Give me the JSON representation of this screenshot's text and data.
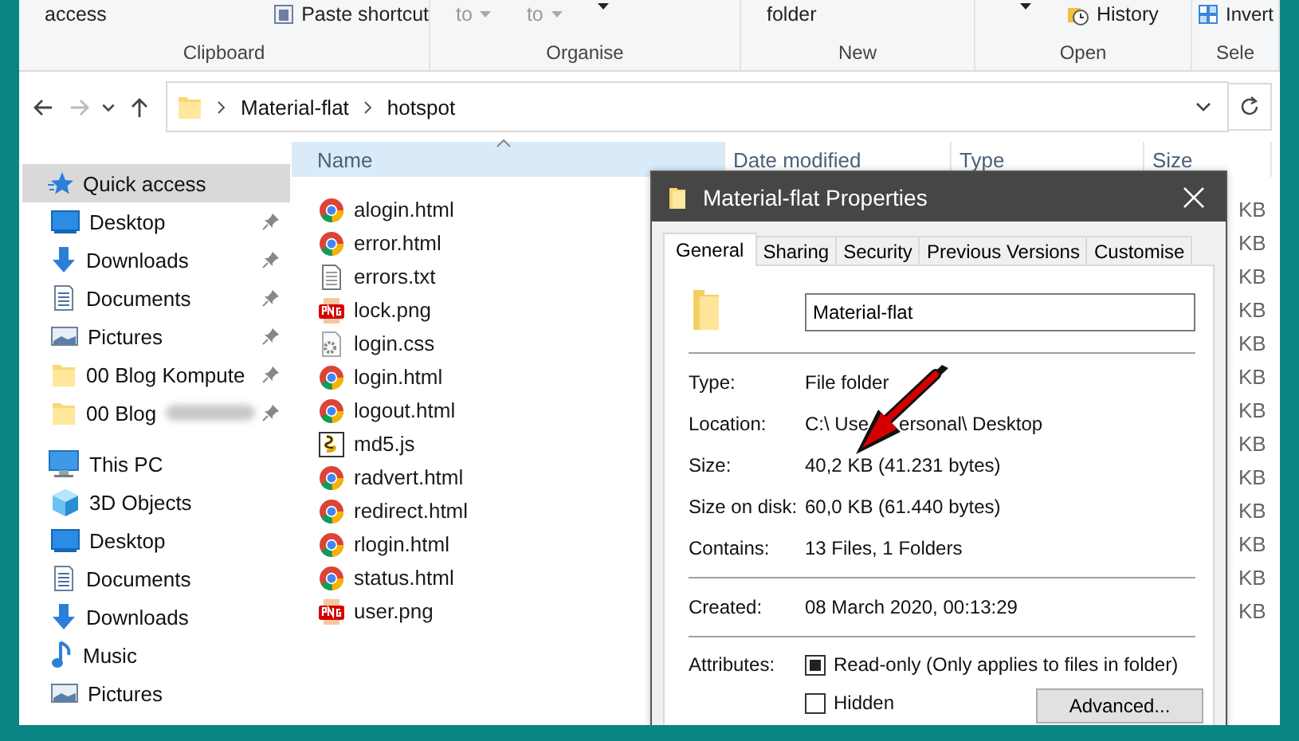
{
  "ribbon": {
    "groups": [
      {
        "label": "Clipboard",
        "items": [
          {
            "kind": "text",
            "text": "access"
          },
          {
            "kind": "paste",
            "text": "Paste shortcut"
          }
        ]
      },
      {
        "label": "Organise",
        "items": [
          {
            "kind": "dropdown",
            "text": "to",
            "disabled": true
          },
          {
            "kind": "dropdown",
            "text": "to",
            "disabled": true
          },
          {
            "kind": "dropdown",
            "disabled": false
          }
        ]
      },
      {
        "label": "New",
        "items": [
          {
            "kind": "text",
            "text": "folder"
          }
        ]
      },
      {
        "label": "Open",
        "items": [
          {
            "kind": "dropdown",
            "disabled": false
          },
          {
            "kind": "history",
            "text": "History"
          }
        ]
      },
      {
        "label": "Sele",
        "items": [
          {
            "kind": "invert",
            "text": "Invert"
          }
        ]
      }
    ]
  },
  "nav": [
    {
      "kind": "back",
      "disabled": false
    },
    {
      "kind": "forward",
      "disabled": true
    },
    {
      "kind": "recent",
      "disabled": false
    },
    {
      "kind": "up",
      "disabled": false
    }
  ],
  "address": {
    "crumbs": [
      "Material-flat",
      "hotspot"
    ]
  },
  "sidebar": [
    {
      "label": "Quick access",
      "kind": "star",
      "selected": true,
      "children": [
        {
          "label": "Desktop",
          "kind": "desktop",
          "pinned": true,
          "blurred": false
        },
        {
          "label": "Downloads",
          "kind": "download",
          "pinned": true,
          "blurred": false
        },
        {
          "label": "Documents",
          "kind": "document",
          "pinned": true,
          "blurred": false
        },
        {
          "label": "Pictures",
          "kind": "pictures",
          "pinned": true,
          "blurred": false
        },
        {
          "label": "00 Blog Kompute",
          "kind": "folder",
          "pinned": true,
          "blurred": false
        },
        {
          "label": "00 Blog",
          "kind": "folder",
          "pinned": true,
          "blurred": true
        }
      ]
    },
    {
      "label": "This PC",
      "kind": "pc",
      "selected": false,
      "children": [
        {
          "label": "3D Objects",
          "kind": "cube",
          "pinned": false
        },
        {
          "label": "Desktop",
          "kind": "desktop",
          "pinned": false
        },
        {
          "label": "Documents",
          "kind": "document",
          "pinned": false
        },
        {
          "label": "Downloads",
          "kind": "download",
          "pinned": false
        },
        {
          "label": "Music",
          "kind": "music",
          "pinned": false
        },
        {
          "label": "Pictures",
          "kind": "pictures",
          "pinned": false
        }
      ]
    }
  ],
  "table": {
    "columns": [
      {
        "label": "Name",
        "sorted": true
      },
      {
        "label": "Date modified",
        "sorted": false
      },
      {
        "label": "Type",
        "sorted": false
      },
      {
        "label": "Size",
        "sorted": false
      }
    ],
    "rows": [
      {
        "name": "alogin.html",
        "kind": "html",
        "size": "KB"
      },
      {
        "name": "error.html",
        "kind": "html",
        "size": "KB"
      },
      {
        "name": "errors.txt",
        "kind": "txt",
        "size": "KB"
      },
      {
        "name": "lock.png",
        "kind": "png",
        "size": "KB"
      },
      {
        "name": "login.css",
        "kind": "css",
        "size": "KB"
      },
      {
        "name": "login.html",
        "kind": "html",
        "size": "KB"
      },
      {
        "name": "logout.html",
        "kind": "html",
        "size": "KB"
      },
      {
        "name": "md5.js",
        "kind": "js",
        "size": "KB"
      },
      {
        "name": "radvert.html",
        "kind": "html",
        "size": "KB"
      },
      {
        "name": "redirect.html",
        "kind": "html",
        "size": "KB"
      },
      {
        "name": "rlogin.html",
        "kind": "html",
        "size": "KB"
      },
      {
        "name": "status.html",
        "kind": "html",
        "size": "KB"
      },
      {
        "name": "user.png",
        "kind": "png",
        "size": "KB"
      }
    ]
  },
  "dialog": {
    "title": "Material-flat Properties",
    "tabs": [
      {
        "label": "General",
        "selected": true
      },
      {
        "label": "Sharing",
        "selected": false
      },
      {
        "label": "Security",
        "selected": false
      },
      {
        "label": "Previous Versions",
        "selected": false
      },
      {
        "label": "Customise",
        "selected": false
      }
    ],
    "name_field": {
      "value": "Material-flat"
    },
    "sections": [
      [
        {
          "label": "Type:",
          "value": "File folder"
        },
        {
          "label": "Location:",
          "value_parts": [
            "C:\\ Use",
            "ersonal\\ Desktop"
          ]
        },
        {
          "label": "Size:",
          "value": "40,2 KB (41.231 bytes)"
        },
        {
          "label": "Size on disk:",
          "value": "60,0 KB (61.440 bytes)"
        },
        {
          "label": "Contains:",
          "value": "13 Files, 1 Folders"
        }
      ],
      [
        {
          "label": "Created:",
          "value": "08 March 2020, 00:13:29"
        }
      ]
    ],
    "attributes": {
      "label": "Attributes:",
      "checkboxes": [
        {
          "label": "Read-only (Only applies to files in folder)",
          "checked": true
        },
        {
          "label": "Hidden",
          "checked": false
        }
      ],
      "button": "Advanced..."
    }
  }
}
